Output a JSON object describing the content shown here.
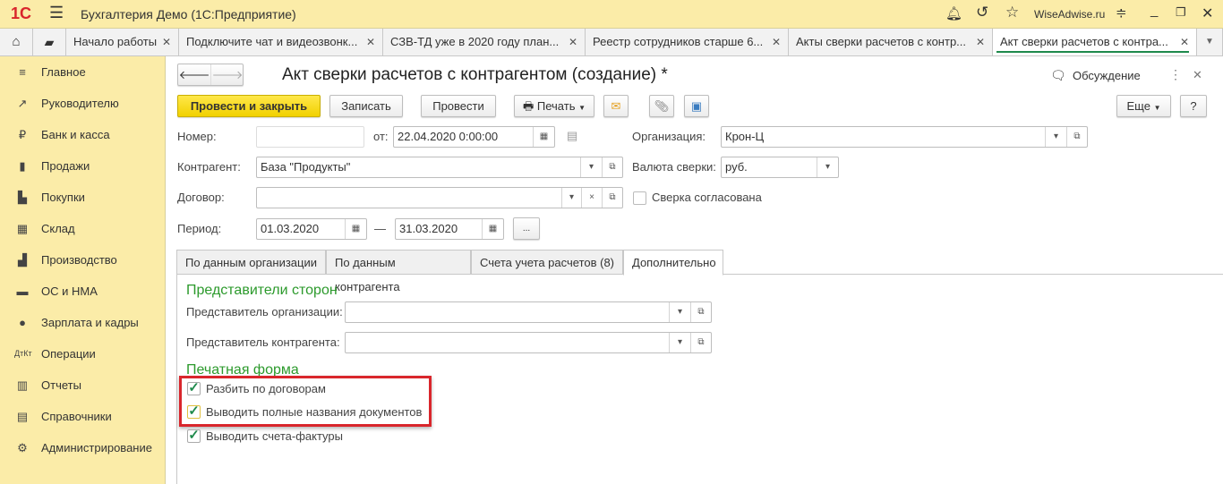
{
  "app": {
    "logo": "1С",
    "title": "Бухгалтерия Демо  (1С:Предприятие)",
    "user": "WiseAdwise.ru"
  },
  "tabs": [
    {
      "label": "Начало работы"
    },
    {
      "label": "Подключите чат и видеозвонк..."
    },
    {
      "label": "СЗВ-ТД уже в 2020 году план..."
    },
    {
      "label": "Реестр сотрудников старше 6..."
    },
    {
      "label": "Акты сверки расчетов с контр..."
    },
    {
      "label": "Акт сверки расчетов с контра..."
    }
  ],
  "sidebar": [
    {
      "label": "Главное"
    },
    {
      "label": "Руководителю"
    },
    {
      "label": "Банк и касса"
    },
    {
      "label": "Продажи"
    },
    {
      "label": "Покупки"
    },
    {
      "label": "Склад"
    },
    {
      "label": "Производство"
    },
    {
      "label": "ОС и НМА"
    },
    {
      "label": "Зарплата и кадры"
    },
    {
      "label": "Операции"
    },
    {
      "label": "Отчеты"
    },
    {
      "label": "Справочники"
    },
    {
      "label": "Администрирование"
    }
  ],
  "form": {
    "title": "Акт сверки расчетов с контрагентом (создание) *",
    "discussion": "Обсуждение",
    "toolbar": {
      "post_close": "Провести и закрыть",
      "save": "Записать",
      "post": "Провести",
      "print": "Печать",
      "more": "Еще",
      "help": "?"
    },
    "number_label": "Номер:",
    "number_value": "",
    "date_label": "от:",
    "date_value": "22.04.2020  0:00:00",
    "org_label": "Организация:",
    "org_value": "Крон-Ц",
    "counterparty_label": "Контрагент:",
    "counterparty_value": "База \"Продукты\"",
    "currency_label": "Валюта сверки:",
    "currency_value": "руб.",
    "contract_label": "Договор:",
    "contract_value": "",
    "agreed_label": "Сверка согласована",
    "period_label": "Период:",
    "period_from": "01.03.2020",
    "period_dash": "—",
    "period_to": "31.03.2020",
    "period_btn": "...",
    "tabs": [
      {
        "label": "По данным организации"
      },
      {
        "label": "По данным контрагента"
      },
      {
        "label": "Счета учета расчетов (8)"
      },
      {
        "label": "Дополнительно"
      }
    ],
    "reps_heading": "Представители сторон",
    "rep_org_label": "Представитель организации:",
    "rep_cp_label": "Представитель контрагента:",
    "print_heading": "Печатная форма",
    "checks": [
      {
        "label": "Разбить по договорам",
        "checked": true
      },
      {
        "label": "Выводить полные названия документов",
        "checked": true
      },
      {
        "label": "Выводить счета-фактуры",
        "checked": true
      }
    ]
  },
  "colors": {
    "accent": "#1f8a4c",
    "highlight": "#d9262c",
    "header": "#fbeca8"
  }
}
